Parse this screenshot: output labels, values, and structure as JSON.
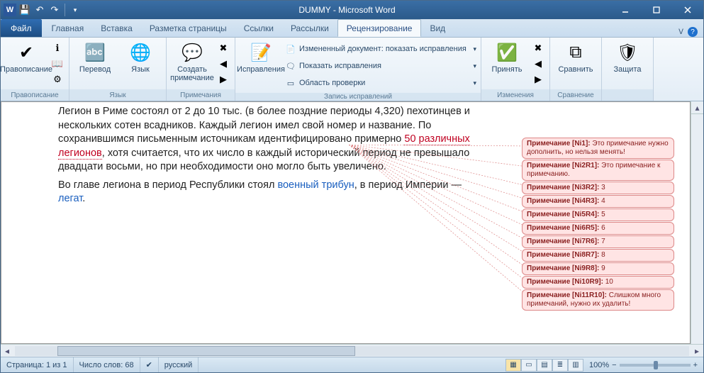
{
  "title": "DUMMY - Microsoft Word",
  "tabs": {
    "file": "Файл",
    "items": [
      "Главная",
      "Вставка",
      "Разметка страницы",
      "Ссылки",
      "Рассылки",
      "Рецензирование",
      "Вид"
    ],
    "active_index": 5
  },
  "ribbon": {
    "groups": [
      {
        "label": "Правописание",
        "big": [
          {
            "icon": "✔",
            "text": "Правописание"
          }
        ]
      },
      {
        "label": "Язык",
        "big": [
          {
            "icon": "🔤",
            "text": "Перевод"
          },
          {
            "icon": "🌐",
            "text": "Язык"
          }
        ]
      },
      {
        "label": "Примечания",
        "big": [
          {
            "icon": "💬",
            "text": "Создать\nпримечание"
          }
        ]
      },
      {
        "label": "Запись исправлений",
        "big": [
          {
            "icon": "📝",
            "text": "Исправления"
          }
        ],
        "rows": [
          {
            "icon": "📄",
            "text": "Измененный документ: показать исправления"
          },
          {
            "icon": "🗨",
            "text": "Показать исправления"
          },
          {
            "icon": "▭",
            "text": "Область проверки"
          }
        ]
      },
      {
        "label": "Изменения",
        "big": [
          {
            "icon": "✅",
            "text": "Принять"
          }
        ]
      },
      {
        "label": "Сравнение",
        "big": [
          {
            "icon": "⧉",
            "text": "Сравнить"
          }
        ]
      },
      {
        "label": "",
        "big": [
          {
            "icon": "🛡",
            "text": "Защита"
          }
        ]
      }
    ]
  },
  "document": {
    "p1_a": "Легион в Риме состоял от 2 до 10 тыс. (в более поздние периоды 4,320) пехотинцев и нескольких сотен всадников. Каждый легион имел свой номер и название. По сохранившимся письменным источникам идентифицировано примерно ",
    "p1_red": "50 различных легионов",
    "p1_b": ", хотя считается, что их число в каждый исторический период не превышало двадцати восьми, но при необходимости оно могло быть увеличено.",
    "p2_a": "Во главе легиона в период Республики стоял ",
    "p2_link1": "военный трибун",
    "p2_b": ", в период Империи — ",
    "p2_link2": "легат",
    "p2_c": "."
  },
  "comments": [
    {
      "author": "Ni1",
      "text": "Это примечание нужно дополнить, но нельзя менять!"
    },
    {
      "author": "Ni2R1",
      "text": "Это примечание к примечанию."
    },
    {
      "author": "Ni3R2",
      "text": "3"
    },
    {
      "author": "Ni4R3",
      "text": "4"
    },
    {
      "author": "Ni5R4",
      "text": "5"
    },
    {
      "author": "Ni6R5",
      "text": "6"
    },
    {
      "author": "Ni7R6",
      "text": "7"
    },
    {
      "author": "Ni8R7",
      "text": "8"
    },
    {
      "author": "Ni9R8",
      "text": "9"
    },
    {
      "author": "Ni10R9",
      "text": "10"
    },
    {
      "author": "Ni11R10",
      "text": "Слишком много примечаний, нужно их удалить!"
    }
  ],
  "comment_prefix": "Примечание",
  "status": {
    "page": "Страница: 1 из 1",
    "words": "Число слов: 68",
    "lang": "русский",
    "zoom": "100%"
  },
  "zoom_buttons": {
    "minus": "−",
    "plus": "+"
  }
}
